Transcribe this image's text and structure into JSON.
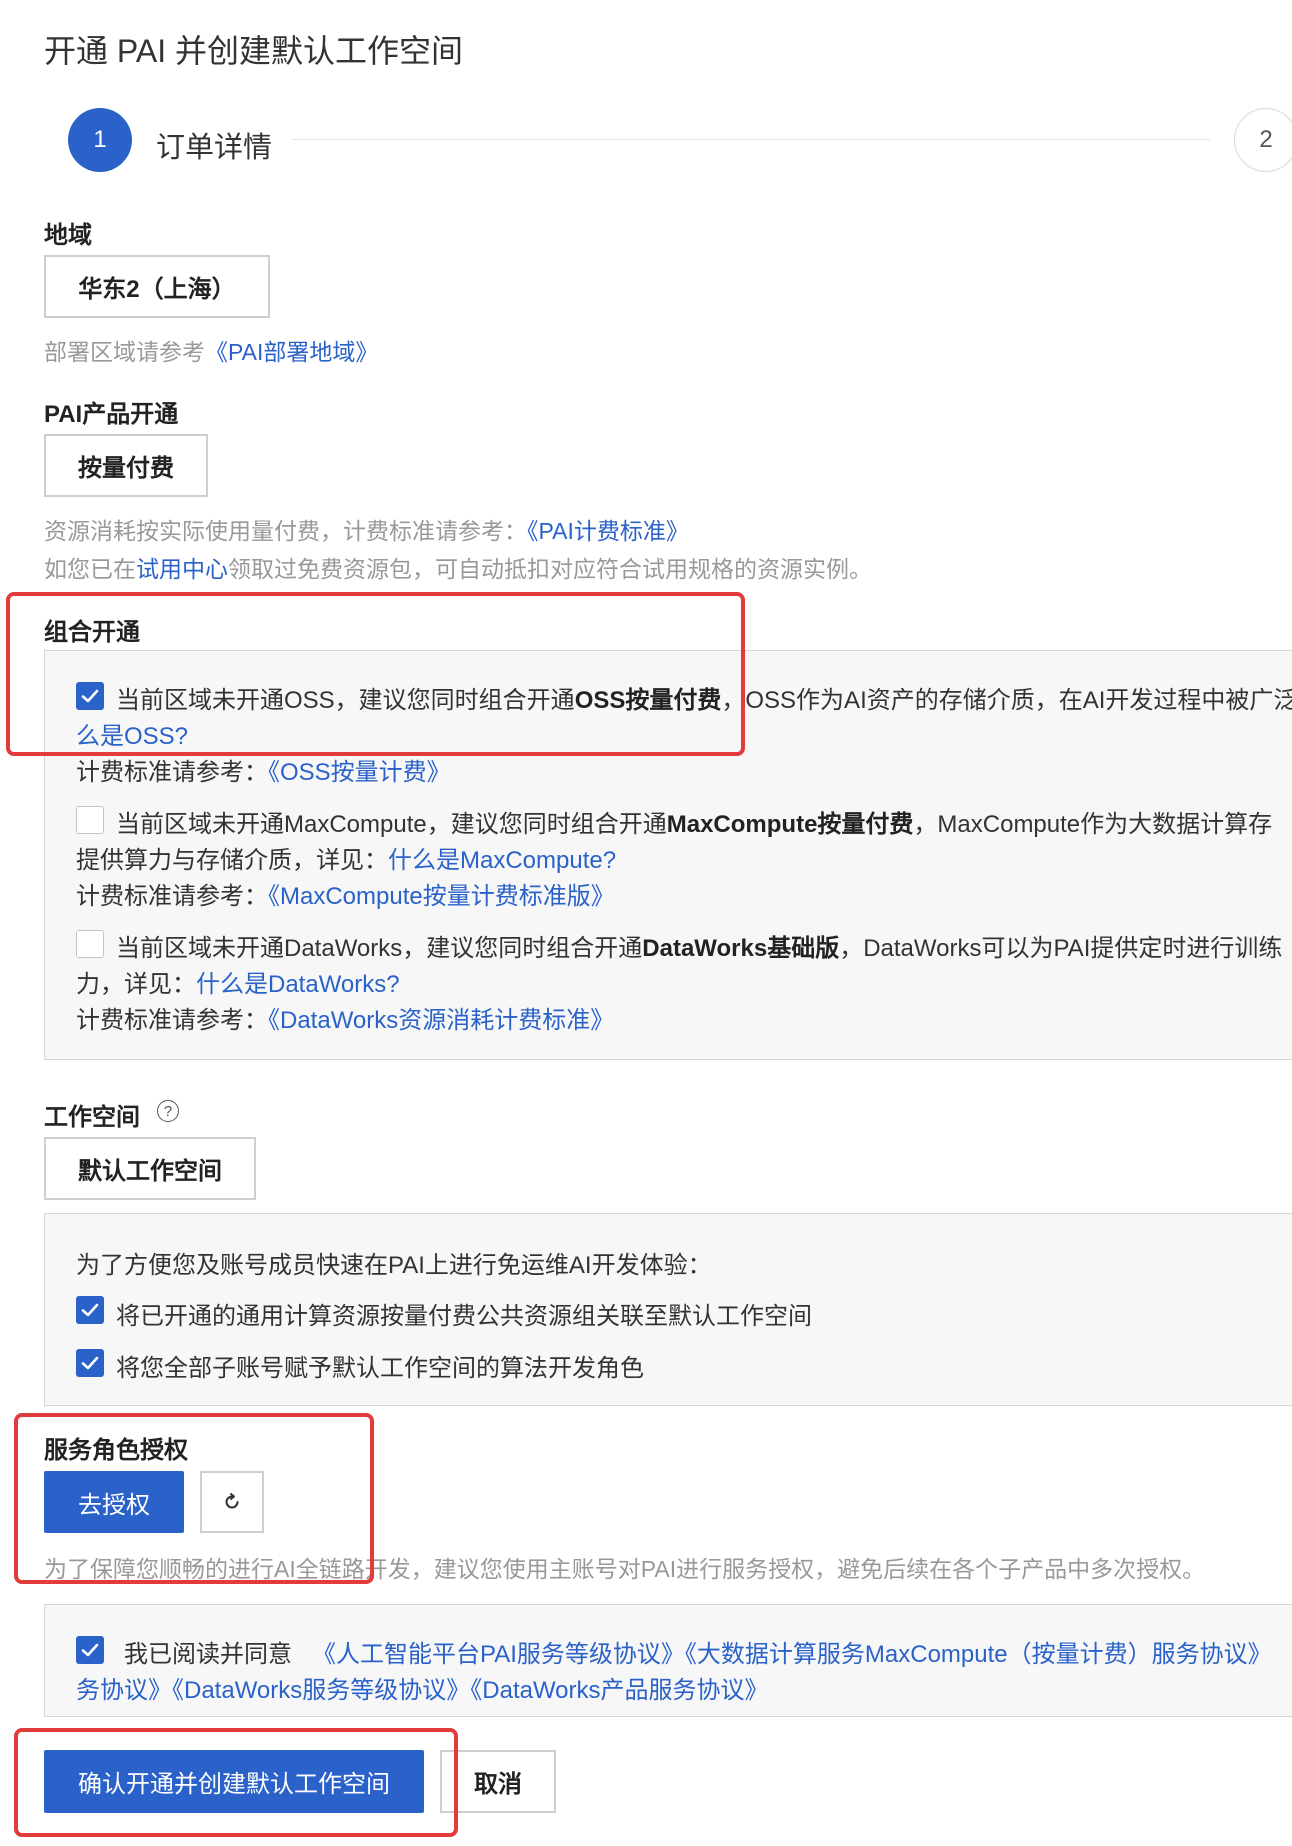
{
  "page_title": "开通 PAI 并创建默认工作空间",
  "steps": [
    {
      "number": "1",
      "label": "订单详情"
    },
    {
      "number": "2"
    }
  ],
  "region": {
    "label": "地域",
    "selected": "华东2（上海）",
    "hint_prefix": "部署区域请参考",
    "hint_link": "《PAI部署地域》"
  },
  "pai_product": {
    "label": "PAI产品开通",
    "selected": "按量付费",
    "hint1_prefix": "资源消耗按实际使用量付费，计费标准请参考：",
    "hint1_link": "《PAI计费标准》",
    "hint2_a": "如您已在",
    "hint2_link": "试用中心",
    "hint2_b": "领取过免费资源包，可自动抵扣对应符合试用规格的资源实例。"
  },
  "combo": {
    "label": "组合开通",
    "oss": {
      "checked": true,
      "line1_a": "当前区域未开通OSS，建议您同时组合开通",
      "line1_bold": "OSS按量付费",
      "line1_b": "，OSS作为AI资产的存储介质，在AI开发过程中被广泛",
      "line2_link": "么是OSS?",
      "line3_prefix": "计费标准请参考：",
      "line3_link": "《OSS按量计费》"
    },
    "maxcompute": {
      "checked": false,
      "line1_a": "当前区域未开通MaxCompute，建议您同时组合开通",
      "line1_bold": "MaxCompute按量付费",
      "line1_b": "，MaxCompute作为大数据计算存",
      "line2_a": "提供算力与存储介质，详见：",
      "line2_link": "什么是MaxCompute?",
      "line3_prefix": "计费标准请参考：",
      "line3_link": "《MaxCompute按量计费标准版》"
    },
    "dataworks": {
      "checked": false,
      "line1_a": "当前区域未开通DataWorks，建议您同时组合开通",
      "line1_bold": "DataWorks基础版",
      "line1_b": "，DataWorks可以为PAI提供定时进行训练",
      "line2_a": "力，详见：",
      "line2_link": "什么是DataWorks?",
      "line3_prefix": "计费标准请参考：",
      "line3_link": "《DataWorks资源消耗计费标准》"
    }
  },
  "workspace": {
    "label": "工作空间",
    "help_icon": "?",
    "selected": "默认工作空间",
    "intro": "为了方便您及账号成员快速在PAI上进行免运维AI开发体验：",
    "option1": "将已开通的通用计算资源按量付费公共资源组关联至默认工作空间",
    "option2": "将您全部子账号赋予默认工作空间的算法开发角色",
    "option1_checked": true,
    "option2_checked": true
  },
  "service_role": {
    "label": "服务角色授权",
    "authorize_button": "去授权",
    "refresh_icon": "refresh-icon",
    "hint": "为了保障您顺畅的进行AI全链路开发，建议您使用主账号对PAI进行服务授权，避免后续在各个子产品中多次授权。"
  },
  "agreement": {
    "checked": true,
    "prefix": "我已阅读并同意",
    "link1": "《人工智能平台PAI服务等级协议》",
    "link2": "《大数据计算服务MaxCompute（按量计费）服务协议》",
    "line2_link1": "务协议》",
    "line2_link2": "《DataWorks服务等级协议》",
    "line2_link3": "《DataWorks产品服务协议》"
  },
  "footer": {
    "confirm_button": "确认开通并创建默认工作空间",
    "cancel_button": "取消"
  },
  "colors": {
    "primary": "#2a62c9",
    "highlight_box": "#e13b3b",
    "panel_bg": "#f7f7f7"
  }
}
